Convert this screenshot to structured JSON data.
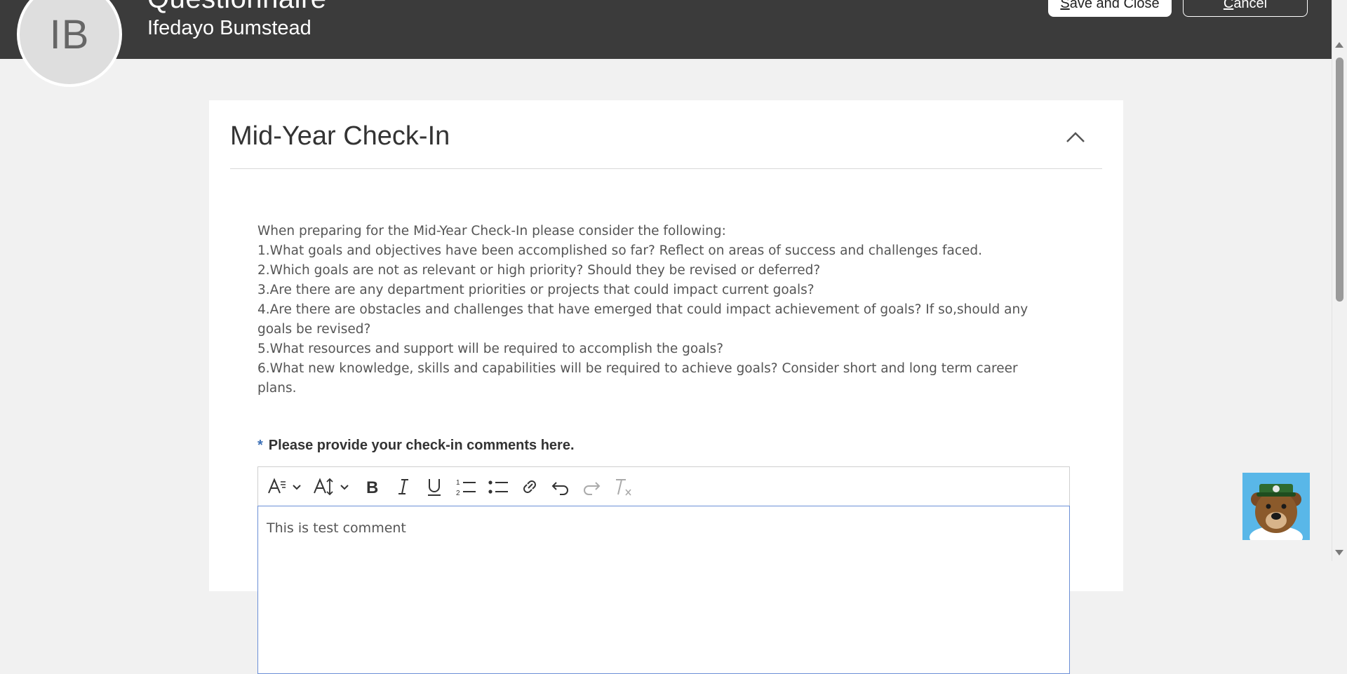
{
  "header": {
    "title": "Questionnaire",
    "person_name": "Ifedayo Bumstead",
    "avatar_initials": "IB",
    "save_label": "Save and Close",
    "cancel_label": "Cancel"
  },
  "section": {
    "title": "Mid-Year Check-In",
    "instructions": [
      "When preparing for the Mid-Year Check-In please consider the following:",
      "1.What goals and objectives have been accomplished so far? Reflect on areas of success and challenges faced.",
      "2.Which goals are not as relevant or high priority? Should they be revised or deferred?",
      "3.Are there are any department priorities or projects that could impact current goals?",
      "4.Are there are obstacles and challenges that have emerged that could impact achievement of goals? If so,should any goals be revised?",
      "5.What resources and support will be required to accomplish the goals?",
      "6.What new knowledge, skills and capabilities will be required to achieve goals? Consider short and long term career plans."
    ]
  },
  "field": {
    "required_marker": "*",
    "label": "Please provide your check-in comments here.",
    "value": "This is test comment"
  },
  "toolbar_icons": [
    "font-style-icon",
    "font-size-icon",
    "bold-icon",
    "italic-icon",
    "underline-icon",
    "numbered-list-icon",
    "bullet-list-icon",
    "link-icon",
    "undo-icon",
    "redo-icon",
    "clear-format-icon"
  ],
  "colors": {
    "header_bg": "#3b3b3b",
    "page_bg": "#f1f1f1",
    "required_marker": "#3b6fb6",
    "editor_focus_border": "#6b8fd6",
    "mascot_bg": "#59b7e8"
  }
}
